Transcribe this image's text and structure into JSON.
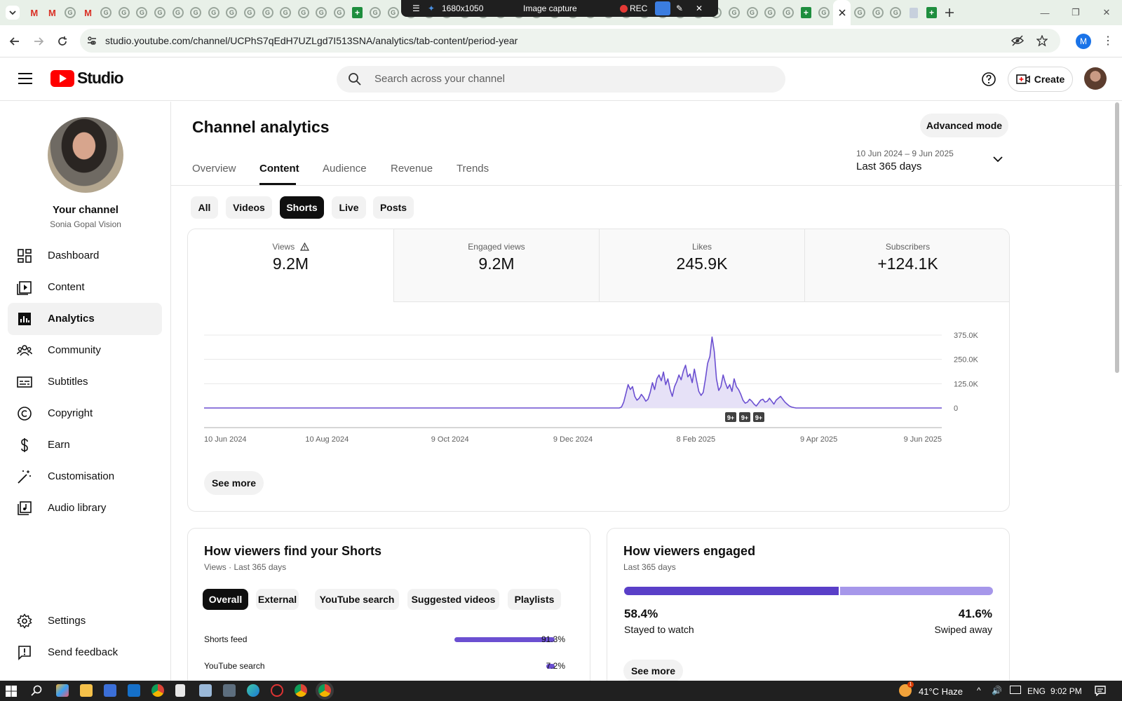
{
  "capture_bar": {
    "size": "1680x1050",
    "mode": "Image capture",
    "rec": "REC"
  },
  "browser": {
    "url": "studio.youtube.com/channel/UCPhS7qEdH7UZLgd7I513SNA/analytics/tab-content/period-year",
    "profile_initial": "M"
  },
  "header": {
    "logo_text": "Studio",
    "search_placeholder": "Search across your channel",
    "create_label": "Create"
  },
  "sidebar": {
    "your_channel": "Your channel",
    "channel_name": "Sonia Gopal Vision",
    "items": [
      {
        "label": "Dashboard",
        "icon": "dashboard-icon"
      },
      {
        "label": "Content",
        "icon": "content-icon"
      },
      {
        "label": "Analytics",
        "icon": "analytics-icon",
        "active": true
      },
      {
        "label": "Community",
        "icon": "community-icon"
      },
      {
        "label": "Subtitles",
        "icon": "subtitles-icon"
      },
      {
        "label": "Copyright",
        "icon": "copyright-icon"
      },
      {
        "label": "Earn",
        "icon": "earn-icon"
      },
      {
        "label": "Customisation",
        "icon": "customisation-icon"
      },
      {
        "label": "Audio library",
        "icon": "audio-library-icon"
      }
    ],
    "bottom": [
      {
        "label": "Settings",
        "icon": "settings-icon"
      },
      {
        "label": "Send feedback",
        "icon": "feedback-icon"
      }
    ]
  },
  "main": {
    "title": "Channel analytics",
    "advanced_mode": "Advanced mode",
    "tabs": [
      "Overview",
      "Content",
      "Audience",
      "Revenue",
      "Trends"
    ],
    "active_tab": "Content",
    "date_range": "10 Jun 2024 – 9 Jun 2025",
    "date_label": "Last 365 days",
    "content_chips": [
      "All",
      "Videos",
      "Shorts",
      "Live",
      "Posts"
    ],
    "active_chip": "Shorts",
    "metrics": [
      {
        "label": "Views",
        "value": "9.2M"
      },
      {
        "label": "Engaged views",
        "value": "9.2M"
      },
      {
        "label": "Likes",
        "value": "245.9K"
      },
      {
        "label": "Subscribers",
        "value": "+124.1K"
      }
    ],
    "see_more": "See more"
  },
  "chart_data": {
    "type": "area",
    "series": [
      {
        "values": [
          0,
          0,
          0,
          0,
          0,
          0,
          0,
          0,
          0,
          0,
          0,
          0,
          0,
          0,
          0,
          0,
          0,
          0,
          0,
          0,
          0,
          0,
          0,
          0,
          0,
          0,
          0,
          0,
          0,
          0,
          0,
          0,
          0,
          0,
          0,
          0,
          0,
          0,
          0,
          0,
          0,
          0,
          0,
          0,
          0,
          0,
          0,
          0,
          0,
          0,
          0,
          0,
          0,
          0,
          0,
          0,
          0,
          0,
          0,
          0,
          0,
          0,
          0,
          0,
          0,
          0,
          0,
          0,
          0,
          0,
          0,
          0,
          0,
          0,
          0,
          0,
          0,
          0,
          0,
          0,
          0,
          0,
          0,
          0,
          0,
          0,
          0,
          0,
          0,
          0,
          0,
          0,
          0,
          0,
          0,
          0,
          0,
          0,
          0,
          0,
          0,
          0,
          0,
          0,
          0,
          0,
          0,
          0,
          0,
          0,
          0,
          0,
          0,
          0,
          0,
          0,
          0,
          0,
          0,
          0,
          0,
          0,
          0,
          0,
          0,
          0,
          0,
          0,
          0,
          0,
          0,
          0,
          0,
          0,
          0,
          0,
          0,
          0,
          0,
          0,
          0,
          0,
          0,
          0,
          0,
          0,
          0,
          0,
          0,
          0,
          0,
          0,
          0,
          0,
          0,
          0,
          0,
          0,
          0,
          0,
          0,
          0,
          0,
          0,
          0,
          0,
          0,
          0,
          0,
          0,
          0,
          0,
          0,
          0,
          0,
          0,
          0,
          0,
          0,
          0,
          0,
          0,
          0,
          0,
          0,
          0,
          0,
          0,
          0,
          5000,
          30000,
          75000,
          120000,
          95000,
          110000,
          60000,
          40000,
          50000,
          70000,
          55000,
          35000,
          45000,
          80000,
          130000,
          95000,
          150000,
          170000,
          140000,
          185000,
          120000,
          150000,
          95000,
          60000,
          110000,
          135000,
          170000,
          145000,
          190000,
          220000,
          160000,
          175000,
          130000,
          200000,
          140000,
          85000,
          65000,
          80000,
          150000,
          230000,
          265000,
          365000,
          290000,
          150000,
          90000,
          110000,
          170000,
          130000,
          100000,
          120000,
          85000,
          150000,
          110000,
          95000,
          70000,
          40000,
          25000,
          30000,
          45000,
          35000,
          20000,
          10000,
          25000,
          40000,
          45000,
          30000,
          35000,
          50000,
          35000,
          20000,
          40000,
          50000,
          60000,
          45000,
          30000,
          20000,
          10000,
          5000,
          2000,
          0,
          0,
          0,
          0,
          0,
          0,
          0,
          0,
          0,
          0,
          0,
          0,
          0,
          0,
          0,
          0,
          0,
          0,
          0,
          0,
          0,
          0,
          0,
          0,
          0,
          0,
          0,
          0,
          0,
          0,
          0,
          0,
          0,
          0,
          0,
          0,
          0,
          0,
          0,
          0,
          0,
          0,
          0,
          0,
          0,
          0,
          0,
          0,
          0,
          0,
          0,
          0,
          0,
          0,
          0,
          0,
          0,
          0,
          0,
          0,
          0,
          0,
          0,
          0,
          0,
          0,
          0
        ]
      }
    ],
    "x_labels": [
      "10 Jun 2024",
      "10 Aug 2024",
      "9 Oct 2024",
      "9 Dec 2024",
      "8 Feb 2025",
      "9 Apr 2025",
      "9 Jun 2025"
    ],
    "y_ticks": [
      "375.0K",
      "250.0K",
      "125.0K",
      "0"
    ],
    "y_tick_values": [
      375000,
      250000,
      125000,
      0
    ],
    "ylim": [
      0,
      375000
    ],
    "markers": [
      "9+",
      "9+",
      "9+"
    ],
    "grid": true,
    "color": "#6b4fd1"
  },
  "find_card": {
    "title": "How viewers find your Shorts",
    "subtitle": "Views · Last 365 days",
    "chips": [
      "Overall",
      "External",
      "YouTube search",
      "Suggested videos",
      "Playlists"
    ],
    "active_chip": "Overall",
    "rows": [
      {
        "label": "Shorts feed",
        "value": "91.3%",
        "fraction": 0.913
      },
      {
        "label": "YouTube search",
        "value": "7.2%",
        "fraction": 0.072
      }
    ]
  },
  "engage_card": {
    "title": "How viewers engaged",
    "subtitle": "Last 365 days",
    "stayed_pct": "58.4%",
    "stayed_label": "Stayed to watch",
    "swiped_pct": "41.6%",
    "swiped_label": "Swiped away",
    "stayed_fraction": 0.584,
    "see_more": "See more"
  },
  "taskbar": {
    "weather": "41°C  Haze",
    "lang": "ENG",
    "time": "9:02 PM",
    "notif_badge": "1"
  }
}
